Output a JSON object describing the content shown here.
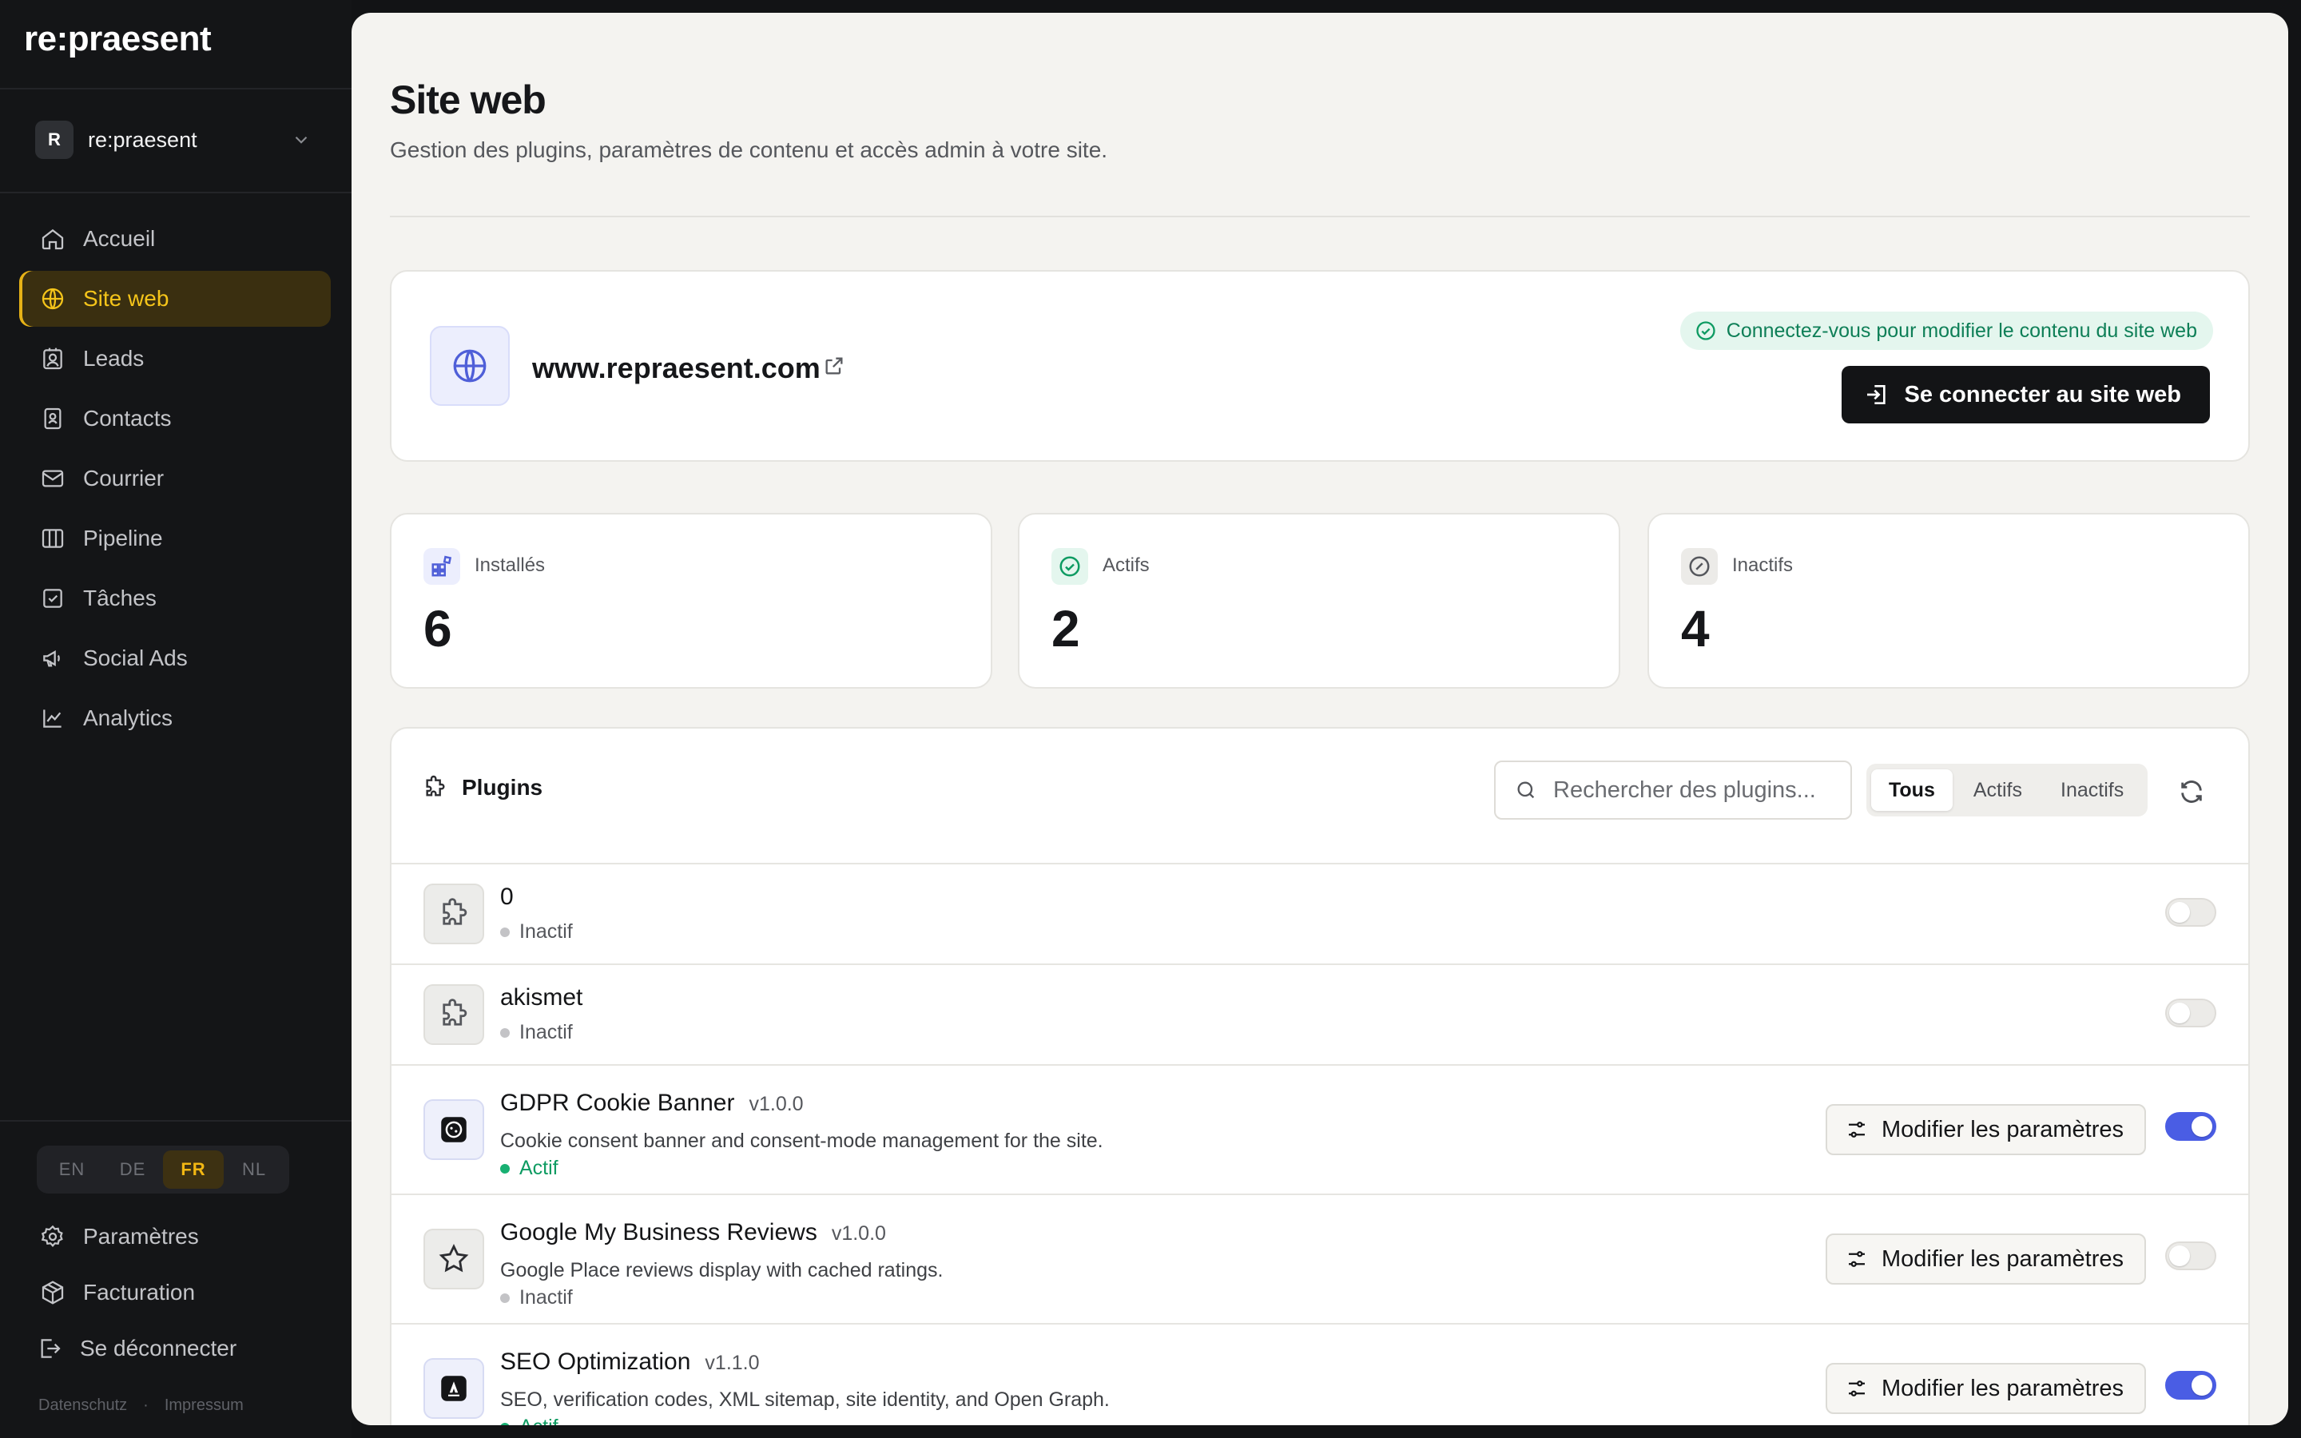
{
  "brand": {
    "logo": "re:praesent"
  },
  "workspace": {
    "initial": "R",
    "name": "re:praesent"
  },
  "nav": {
    "items": [
      {
        "label": "Accueil",
        "icon": "home-icon"
      },
      {
        "label": "Site web",
        "icon": "globe-icon",
        "active": true
      },
      {
        "label": "Leads",
        "icon": "lead-icon"
      },
      {
        "label": "Contacts",
        "icon": "contacts-icon"
      },
      {
        "label": "Courrier",
        "icon": "mail-icon"
      },
      {
        "label": "Pipeline",
        "icon": "pipeline-icon"
      },
      {
        "label": "Tâches",
        "icon": "tasks-icon"
      },
      {
        "label": "Social Ads",
        "icon": "megaphone-icon"
      },
      {
        "label": "Analytics",
        "icon": "chart-icon"
      }
    ]
  },
  "languages": {
    "items": [
      "EN",
      "DE",
      "FR",
      "NL"
    ],
    "active": "FR"
  },
  "sidebar_bottom": {
    "settings": "Paramètres",
    "billing": "Facturation",
    "logout": "Se déconnecter",
    "footer": {
      "privacy": "Datenschutz",
      "separator": "·",
      "imprint": "Impressum"
    }
  },
  "page": {
    "title": "Site web",
    "subtitle": "Gestion des plugins, paramètres de contenu et accès admin à votre site."
  },
  "site": {
    "domain": "www.repraesent.com",
    "notice": "Connectez-vous pour modifier le contenu du site web",
    "connect_button": "Se connecter au site web"
  },
  "stats": {
    "installed": {
      "label": "Installés",
      "value": "6"
    },
    "active": {
      "label": "Actifs",
      "value": "2"
    },
    "inactive": {
      "label": "Inactifs",
      "value": "4"
    }
  },
  "plugins": {
    "title": "Plugins",
    "search_placeholder": "Rechercher des plugins...",
    "filters": [
      "Tous",
      "Actifs",
      "Inactifs"
    ],
    "active_filter": "Tous",
    "edit_label": "Modifier les paramètres",
    "list": [
      {
        "name": "0",
        "version": "",
        "description": "",
        "status": "Inactif",
        "enabled": false
      },
      {
        "name": "akismet",
        "version": "",
        "description": "",
        "status": "Inactif",
        "enabled": false
      },
      {
        "name": "GDPR Cookie Banner",
        "version": "v1.0.0",
        "description": "Cookie consent banner and consent-mode management for the site.",
        "status": "Actif",
        "enabled": true
      },
      {
        "name": "Google My Business Reviews",
        "version": "v1.0.0",
        "description": "Google Place reviews display with cached ratings.",
        "status": "Inactif",
        "enabled": false
      },
      {
        "name": "SEO Optimization",
        "version": "v1.1.0",
        "description": "SEO, verification codes, XML sitemap, site identity, and Open Graph.",
        "status": "Actif",
        "enabled": true
      }
    ]
  },
  "colors": {
    "accent": "#f5c51a",
    "toggle_on": "#4a5de4",
    "success": "#0e9b62",
    "sidebar_bg": "#141517",
    "main_bg": "#f4f3f0"
  }
}
